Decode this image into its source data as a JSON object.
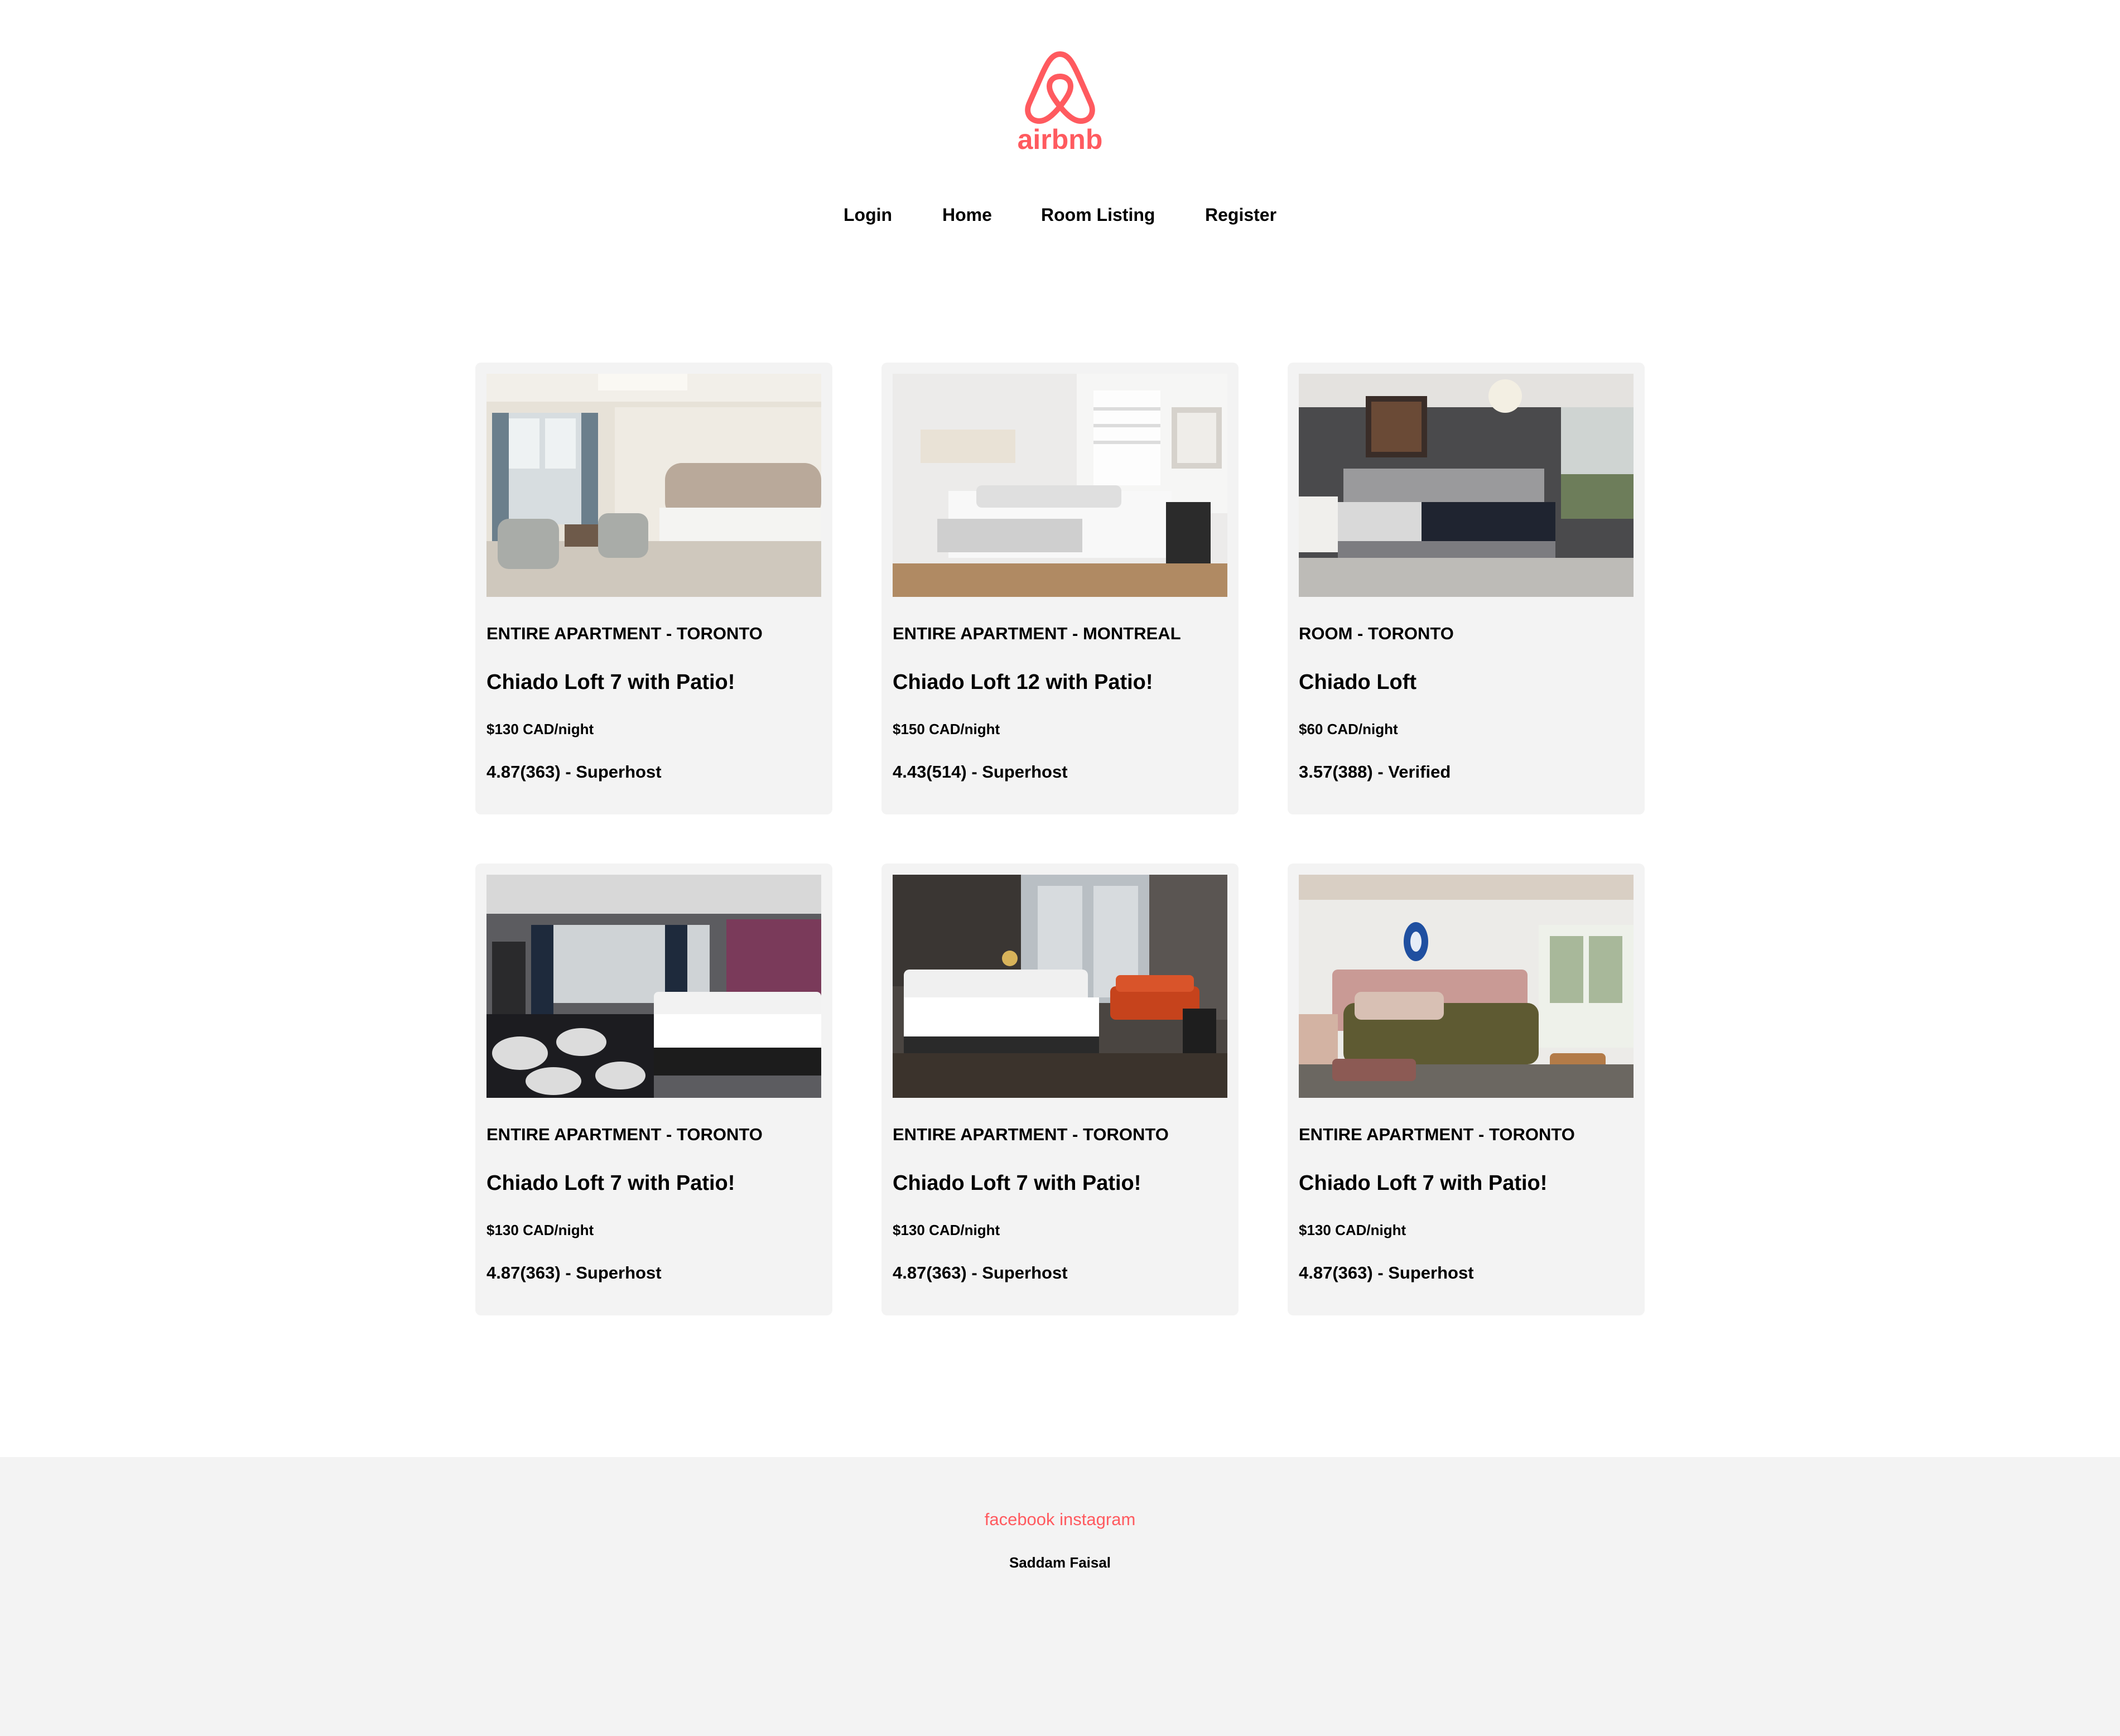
{
  "brand": {
    "name": "airbnb",
    "color": "#ff5a5f"
  },
  "nav": {
    "login": "Login",
    "home": "Home",
    "room_listing": "Room Listing",
    "register": "Register"
  },
  "listings": [
    {
      "type": "ENTIRE APARTMENT - TORONTO",
      "title": "Chiado Loft 7 with Patio!",
      "price": "$130 CAD/night",
      "rating": "4.87(363) - Superhost",
      "image": "bedroom-photo-light-classic"
    },
    {
      "type": "ENTIRE APARTMENT - MONTREAL",
      "title": "Chiado Loft 12 with Patio!",
      "price": "$150 CAD/night",
      "rating": "4.43(514) - Superhost",
      "image": "bedroom-photo-white-minimal"
    },
    {
      "type": "ROOM - TORONTO",
      "title": "Chiado Loft",
      "price": "$60 CAD/night",
      "rating": "3.57(388) - Verified",
      "image": "bedroom-photo-dark-grey"
    },
    {
      "type": "ENTIRE APARTMENT - TORONTO",
      "title": "Chiado Loft 7 with Patio!",
      "price": "$130 CAD/night",
      "rating": "4.87(363) - Superhost",
      "image": "bedroom-photo-hotel-dark-carpet"
    },
    {
      "type": "ENTIRE APARTMENT - TORONTO",
      "title": "Chiado Loft 7 with Patio!",
      "price": "$130 CAD/night",
      "rating": "4.87(363) - Superhost",
      "image": "bedroom-photo-hotel-orange-sofa"
    },
    {
      "type": "ENTIRE APARTMENT - TORONTO",
      "title": "Chiado Loft 7 with Patio!",
      "price": "$130 CAD/night",
      "rating": "4.87(363) - Superhost",
      "image": "bedroom-photo-olive-bedding"
    }
  ],
  "footer": {
    "facebook": "facebook",
    "instagram": "instagram",
    "author": "Saddam Faisal"
  }
}
